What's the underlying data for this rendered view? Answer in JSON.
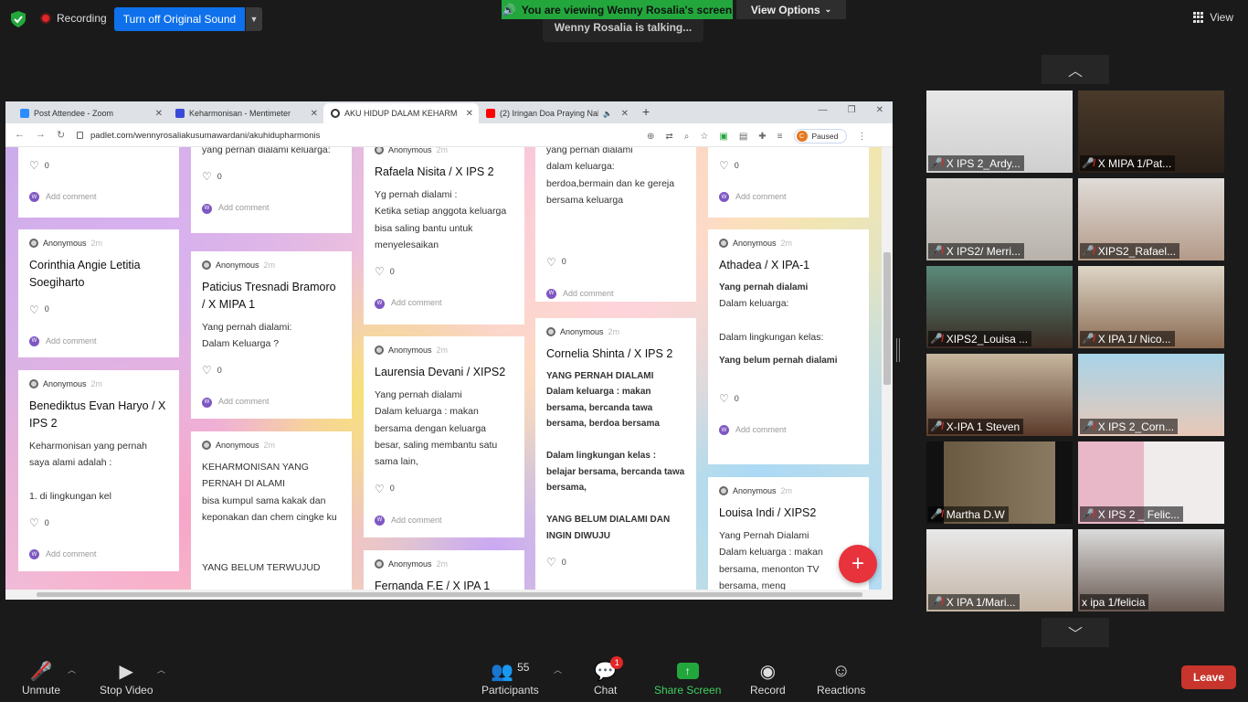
{
  "zoom": {
    "recording": "Recording",
    "original_sound_button": "Turn off Original Sound",
    "viewing_banner": "You are viewing Wenny Rosalia's screen",
    "view_options": "View Options",
    "talking": "Wenny Rosalia is talking...",
    "view": "View",
    "participants_count": "55",
    "chat_badge": "1",
    "toolbar": {
      "unmute": "Unmute",
      "stop_video": "Stop Video",
      "participants": "Participants",
      "chat": "Chat",
      "share_screen": "Share Screen",
      "record": "Record",
      "reactions": "Reactions",
      "leave": "Leave"
    },
    "participants": [
      "X IPS 2_Ardy...",
      "X MIPA 1/Pat...",
      "X IPS2/ Merri...",
      "XIPS2_Rafael...",
      "XIPS2_Louisa ...",
      "X IPA 1/ Nico...",
      "X-IPA 1 Steven",
      "X IPS 2_Corn...",
      "Martha D.W",
      "X IPS 2 _ Felic...",
      "X IPA 1/Mari...",
      "x ipa 1/felicia"
    ]
  },
  "browser": {
    "tabs": [
      "Post Attendee - Zoom",
      "Keharmonisan - Mentimeter",
      "AKU HIDUP DALAM KEHARMON",
      "(2) Iringan Doa Praying Nak"
    ],
    "url": "padlet.com/wennyrosaliakusumawardani/akuhidupharmonis",
    "paused": "Paused",
    "profile_initial": "C"
  },
  "padlet": {
    "anonymous": "Anonymous",
    "ago": "2m",
    "add_comment": "Add comment",
    "commenter_initial": "W",
    "posts": [
      {
        "title": "",
        "body": "",
        "likes": "0"
      },
      {
        "title": "Corinthia Angie Letitia Soegiharto",
        "body": "",
        "likes": "0"
      },
      {
        "title": "Benediktus Evan Haryo / X IPS 2",
        "body": "Keharmonisan yang pernah saya alami adalah :\n\n1. di lingkungan kel",
        "likes": "0"
      },
      {
        "title": "",
        "body": "yang pernah dialami keluarga:",
        "likes": "0"
      },
      {
        "title": "Paticius Tresnadi Bramoro / X MIPA 1",
        "body": "Yang pernah dialami:\nDalam Keluarga ?",
        "likes": "0"
      },
      {
        "title": "",
        "body": "KEHARMONISAN YANG PERNAH DI ALAMI\nbisa kumpul sama kakak dan keponakan dan chem cingke ku\n\n\nYANG BELUM TERWUJUD",
        "likes": ""
      },
      {
        "title": "Rafaela Nisita / X IPS 2",
        "body": "Yg pernah dialami :\nKetika setiap anggota keluarga bisa saling bantu untuk menyelesaikan",
        "likes": "0"
      },
      {
        "title": "Laurensia Devani / XIPS2",
        "body": "Yang pernah dialami\nDalam keluarga : makan bersama dengan keluarga besar, saling membantu satu sama lain,",
        "likes": "0"
      },
      {
        "title": "Fernanda F.E / X IPA 1",
        "body": "",
        "likes": ""
      },
      {
        "title": "",
        "body": "yang pernah dialami\ndalam keluarga:\nberdoa,bermain dan ke gereja bersama keluarga",
        "likes": "0"
      },
      {
        "title": "Cornelia Shinta / X IPS 2",
        "body": "YANG PERNAH DIALAMI\nDalam keluarga : makan bersama, bercanda tawa bersama, berdoa bersama\n\nDalam lingkungan kelas :\nbelajar bersama, bercanda tawa bersama,\n\nYANG BELUM DIALAMI DAN INGIN DIWUJU",
        "likes": "0"
      },
      {
        "title": "",
        "body": "",
        "likes": "0"
      },
      {
        "title": "Athadea / X IPA-1",
        "body_bold_1": "Yang pernah dialami",
        "body": "Dalam keluarga:\n\nDalam lingkungan kelas:",
        "body_bold_2": "Yang belum pernah dialami",
        "likes": "0"
      },
      {
        "title": "Louisa Indi / XIPS2",
        "body": "Yang Pernah Dialami\nDalam keluarga : makan bersama, menonton TV bersama, meng",
        "likes": ""
      }
    ]
  },
  "colors": {
    "zoom_blue": "#0e71eb",
    "zoom_green": "#23a73d",
    "leave_red": "#c8352c",
    "fab_red": "#e8323c"
  }
}
